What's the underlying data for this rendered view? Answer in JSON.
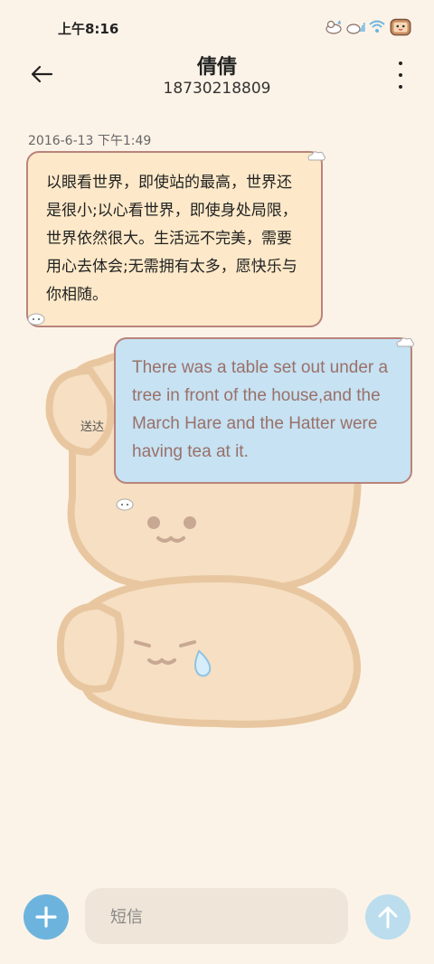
{
  "status_bar": {
    "time": "上午8:16",
    "icons": [
      "bear-icon",
      "signal-bear-icon",
      "wifi-icon",
      "battery-toast-icon"
    ]
  },
  "header": {
    "title": "倩倩",
    "subtitle": "18730218809"
  },
  "conversation": {
    "timestamp": "2016-6-13 下午1:49",
    "incoming_message": "以眼看世界，即使站的最高，世界还是很小;以心看世界，即使身处局限，世界依然很大。生活远不完美，需要用心去体会;无需拥有太多，愿快乐与你相随。",
    "outgoing_message": "There was a table set out under a tree in front of the house,and the March Hare and the Hatter were having tea at it.",
    "outgoing_status": "送达"
  },
  "composer": {
    "placeholder": "短信"
  },
  "colors": {
    "background": "#FCF3E8",
    "incoming_bubble": "#FDE9C9",
    "outgoing_bubble": "#C6E2F3",
    "bubble_border": "#B9837B",
    "outgoing_text": "#9A7069",
    "accent_blue": "#6CB4DE"
  }
}
